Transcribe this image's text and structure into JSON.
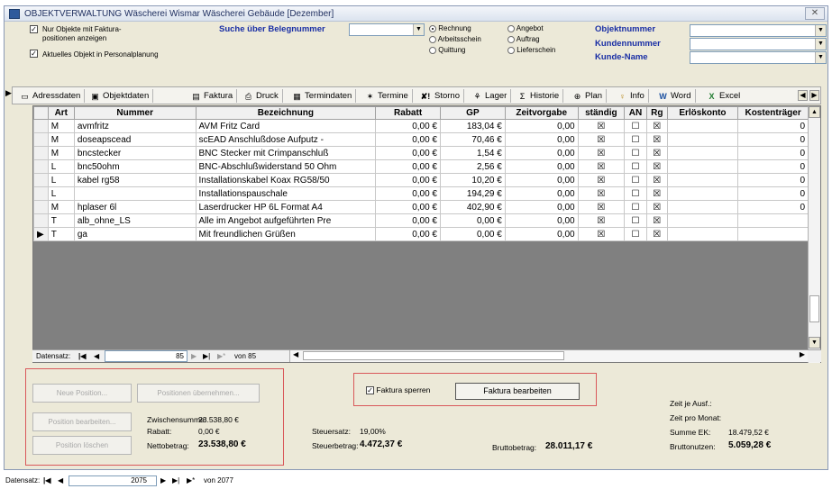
{
  "window": {
    "title": "OBJEKTVERWALTUNG  Wäscherei Wismar  Wäscherei Gebäude  [Dezember]",
    "close": "✕"
  },
  "filters": {
    "only_billing_label": "Nur Objekte mit Faktura-",
    "only_billing_label2": "positionen anzeigen",
    "current_object_label": "Aktuelles Objekt in Personalplanung",
    "search_label": "Suche über Belegnummer",
    "doc_types": [
      "Rechnung",
      "Arbeitsschein",
      "Quittung",
      "Angebot",
      "Auftrag",
      "Lieferschein"
    ],
    "doc_type_selected": "Rechnung",
    "right_labels": [
      "Objektnummer",
      "Kundennummer",
      "Kunde-Name"
    ]
  },
  "toolbar": {
    "items": [
      {
        "icon": "address-icon",
        "glyph": "▭",
        "label": "Adressdaten"
      },
      {
        "icon": "object-icon",
        "glyph": "▣",
        "label": "Objektdaten"
      },
      {
        "icon": "invoice-icon",
        "glyph": "▤",
        "label": "Faktura"
      },
      {
        "icon": "print-icon",
        "glyph": "⎙",
        "label": "Druck"
      },
      {
        "icon": "calendar-icon",
        "glyph": "▦",
        "label": "Termindaten"
      },
      {
        "icon": "appointments-icon",
        "glyph": "✶",
        "label": "Termine"
      },
      {
        "icon": "cancel-icon",
        "glyph": "✘!",
        "label": "Storno"
      },
      {
        "icon": "warehouse-icon",
        "glyph": "⚘",
        "label": "Lager"
      },
      {
        "icon": "history-icon",
        "glyph": "Σ",
        "label": "Historie"
      },
      {
        "icon": "plan-icon",
        "glyph": "⊕",
        "label": "Plan"
      },
      {
        "icon": "info-icon",
        "glyph": "♀",
        "label": "Info"
      },
      {
        "icon": "word-icon",
        "glyph": "W",
        "label": "Word"
      },
      {
        "icon": "excel-icon",
        "glyph": "X",
        "label": "Excel"
      }
    ]
  },
  "table": {
    "columns": [
      "Art",
      "Nummer",
      "Bezeichnung",
      "Rabatt",
      "GP",
      "Zeitvorgabe",
      "ständig",
      "AN",
      "Rg",
      "Erlöskonto",
      "Kostenträger"
    ],
    "rows": [
      {
        "art": "M",
        "nummer": "avmfritz",
        "bez": "AVM Fritz Card",
        "rabatt": "0,00 €",
        "gp": "183,04 €",
        "zeit": "0,00",
        "staendig": "☒",
        "an": "☐",
        "rg": "☒",
        "erl": "",
        "kost": "0"
      },
      {
        "art": "M",
        "nummer": "doseapscead",
        "bez": "scEAD Anschlußdose Aufputz -",
        "rabatt": "0,00 €",
        "gp": "70,46 €",
        "zeit": "0,00",
        "staendig": "☒",
        "an": "☐",
        "rg": "☒",
        "erl": "",
        "kost": "0"
      },
      {
        "art": "M",
        "nummer": "bncstecker",
        "bez": "BNC Stecker mit Crimpanschluß",
        "rabatt": "0,00 €",
        "gp": "1,54 €",
        "zeit": "0,00",
        "staendig": "☒",
        "an": "☐",
        "rg": "☒",
        "erl": "",
        "kost": "0"
      },
      {
        "art": "L",
        "nummer": "bnc50ohm",
        "bez": "BNC-Abschlußwiderstand 50 Ohm",
        "rabatt": "0,00 €",
        "gp": "2,56 €",
        "zeit": "0,00",
        "staendig": "☒",
        "an": "☐",
        "rg": "☒",
        "erl": "",
        "kost": "0"
      },
      {
        "art": "L",
        "nummer": "kabel rg58",
        "bez": "Installationskabel Koax RG58/50",
        "rabatt": "0,00 €",
        "gp": "10,20 €",
        "zeit": "0,00",
        "staendig": "☒",
        "an": "☐",
        "rg": "☒",
        "erl": "",
        "kost": "0"
      },
      {
        "art": "L",
        "nummer": "",
        "bez": "Installationspauschale",
        "rabatt": "0,00 €",
        "gp": "194,29 €",
        "zeit": "0,00",
        "staendig": "☒",
        "an": "☐",
        "rg": "☒",
        "erl": "",
        "kost": "0"
      },
      {
        "art": "M",
        "nummer": "hplaser 6l",
        "bez": "Laserdrucker HP 6L Format A4",
        "rabatt": "0,00 €",
        "gp": "402,90 €",
        "zeit": "0,00",
        "staendig": "☒",
        "an": "☐",
        "rg": "☒",
        "erl": "",
        "kost": "0"
      },
      {
        "art": "T",
        "nummer": "alb_ohne_LS",
        "bez": "Alle im Angebot aufgeführten Pre",
        "rabatt": "0,00 €",
        "gp": "0,00 €",
        "zeit": "0,00",
        "staendig": "☒",
        "an": "☐",
        "rg": "☒",
        "erl": "",
        "kost": ""
      },
      {
        "art": "T",
        "nummer": "ga",
        "bez": "Mit freundlichen Grüßen",
        "rabatt": "0,00 €",
        "gp": "0,00 €",
        "zeit": "0,00",
        "staendig": "☒",
        "an": "☐",
        "rg": "☒",
        "erl": "",
        "kost": ""
      }
    ],
    "current_row_marker": "▶"
  },
  "inner_nav": {
    "label": "Datensatz:",
    "current": "85",
    "of": "von 85"
  },
  "outer_nav": {
    "label": "Datensatz:",
    "current": "2075",
    "of": "von 2077"
  },
  "buttons": {
    "new_position": "Neue Position...",
    "take_positions": "Positionen übernehmen...",
    "edit_position": "Position bearbeiten...",
    "delete_position": "Position löschen",
    "lock_invoice": "Faktura sperren",
    "edit_invoice": "Faktura bearbeiten"
  },
  "totals": {
    "subtotal_label": "Zwischensumme:",
    "subtotal": "23.538,80 €",
    "discount_label": "Rabatt:",
    "discount": "0,00 €",
    "net_label": "Nettobetrag:",
    "net": "23.538,80 €",
    "tax_rate_label": "Steuersatz:",
    "tax_rate": "19,00%",
    "tax_label": "Steuerbetrag:",
    "tax": "4.472,37 €",
    "gross_label": "Bruttobetrag:",
    "gross": "28.011,17 €",
    "time_per_exec_label": "Zeit je Ausf.:",
    "time_per_month_label": "Zeit pro Monat:",
    "sum_ek_label": "Summe EK:",
    "sum_ek": "18.479,52 €",
    "gross_profit_label": "Bruttonutzen:",
    "gross_profit": "5.059,28 €"
  }
}
